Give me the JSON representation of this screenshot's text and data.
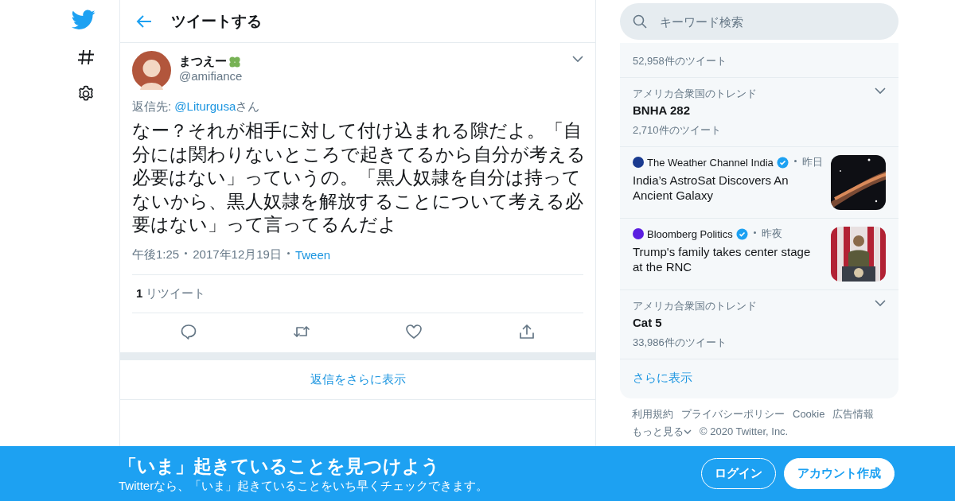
{
  "header": {
    "title": "ツイートする"
  },
  "tweet": {
    "name": "まつえー",
    "handle": "@amifiance",
    "reply_prefix": "返信先: ",
    "reply_to": "@Liturgusa",
    "reply_suffix": "さん",
    "text": "なー？それが相手に対して付け込まれる隙だよ。「自分には関わりないところで起きてるから自分が考える必要はない」っていうの。「黒人奴隷を自分は持ってないから、黒人奴隷を解放することについて考える必要はない」って言ってるんだよ",
    "time": "午後1:25",
    "date": "2017年12月19日",
    "source": "Tween",
    "retweet_count": "1",
    "retweet_label": "リツイート"
  },
  "more_replies": "返信をさらに表示",
  "search": {
    "placeholder": "キーワード検索"
  },
  "trends": [
    {
      "kind": "count",
      "count": "52,958件のツイート"
    },
    {
      "kind": "trend",
      "context": "アメリカ合衆国のトレンド",
      "title": "BNHA 282",
      "count": "2,710件のツイート"
    },
    {
      "kind": "news",
      "source": "The Weather Channel India",
      "color": "#1a3a8f",
      "verified": true,
      "time": "昨日",
      "headline": "India’s AstroSat Discovers An Ancient Galaxy"
    },
    {
      "kind": "news",
      "source": "Bloomberg Politics",
      "color": "#5b1ee0",
      "verified": true,
      "time": "昨夜",
      "headline": "Trump's family takes center stage at the RNC"
    },
    {
      "kind": "trend",
      "context": "アメリカ合衆国のトレンド",
      "title": "Cat 5",
      "count": "33,986件のツイート"
    }
  ],
  "show_more": "さらに表示",
  "footer": {
    "links": [
      "利用規約",
      "プライバシーポリシー",
      "Cookie",
      "広告情報"
    ],
    "more": "もっと見る",
    "copyright": "© 2020 Twitter, Inc."
  },
  "banner": {
    "title": "「いま」起きていることを見つけよう",
    "subtitle": "Twitterなら、「いま」起きていることをいち早くチェックできます。",
    "buttons": [
      {
        "label": "ログイン",
        "kind": "outline"
      },
      {
        "label": "アカウント作成",
        "kind": "filled"
      }
    ]
  }
}
